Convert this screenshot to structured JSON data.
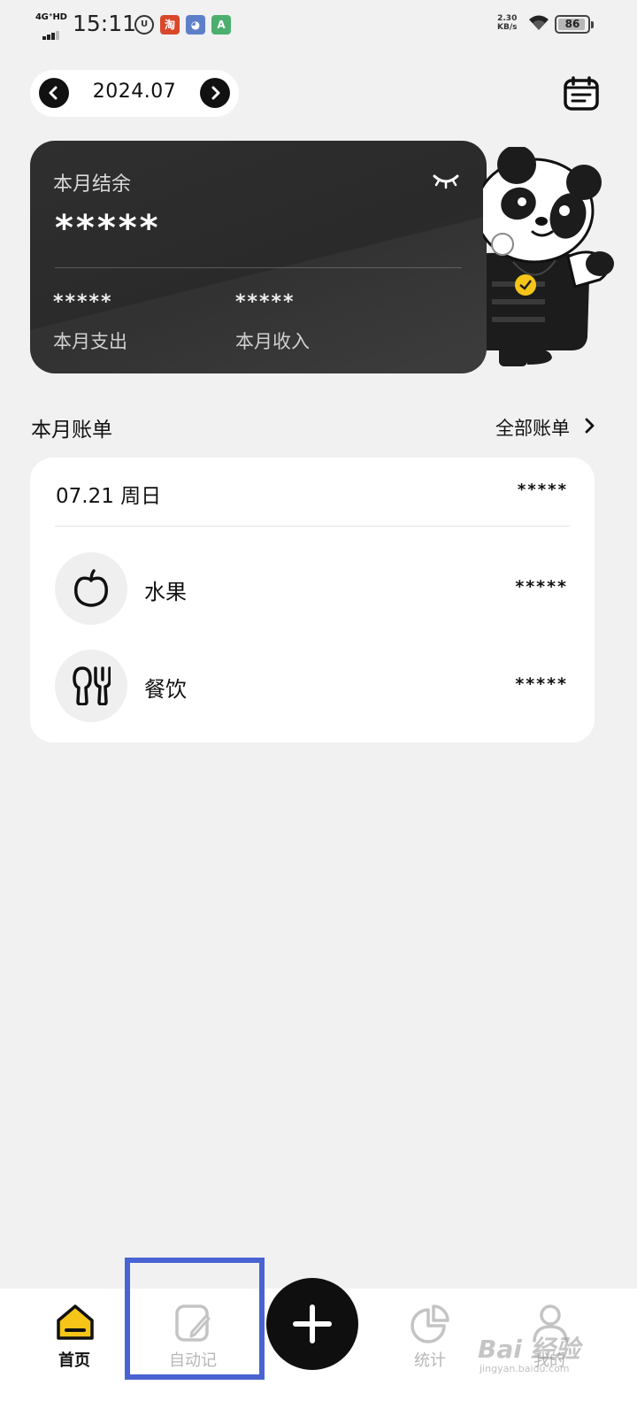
{
  "status_bar": {
    "network": "4G⁺HD",
    "time": "15:11",
    "speed_value": "2.30",
    "speed_unit": "KB/s",
    "battery": "86",
    "app_icons": [
      {
        "name": "unicom-icon",
        "glyph": "U",
        "color": "#333333"
      },
      {
        "name": "taobao-icon",
        "glyph": "淘",
        "color": "#d9482b"
      },
      {
        "name": "cartoon-app-icon",
        "glyph": "◕",
        "color": "#5c7fc8"
      },
      {
        "name": "a-app-icon",
        "glyph": "A",
        "color": "#4caf6e"
      }
    ]
  },
  "header": {
    "month": "2024.07"
  },
  "balance_card": {
    "title": "本月结余",
    "balance": "*****",
    "expense_value": "*****",
    "expense_label": "本月支出",
    "income_value": "*****",
    "income_label": "本月收入"
  },
  "bills_section": {
    "title": "本月账单",
    "all_link": "全部账单"
  },
  "bill_group": {
    "date": "07.21 周日",
    "total": "*****",
    "items": [
      {
        "name": "水果",
        "amount": "*****",
        "icon": "fruit-icon"
      },
      {
        "name": "餐饮",
        "amount": "*****",
        "icon": "dining-icon"
      }
    ]
  },
  "bottom_nav": {
    "home": "首页",
    "auto": "自动记",
    "stats": "统计",
    "mine": "我的"
  },
  "watermark": {
    "brand": "Bai 经验",
    "url": "jingyan.baidu.com"
  },
  "colors": {
    "accent_yellow": "#f5c518",
    "card_dark": "#2e2e2e",
    "highlight": "#4a63d2"
  }
}
